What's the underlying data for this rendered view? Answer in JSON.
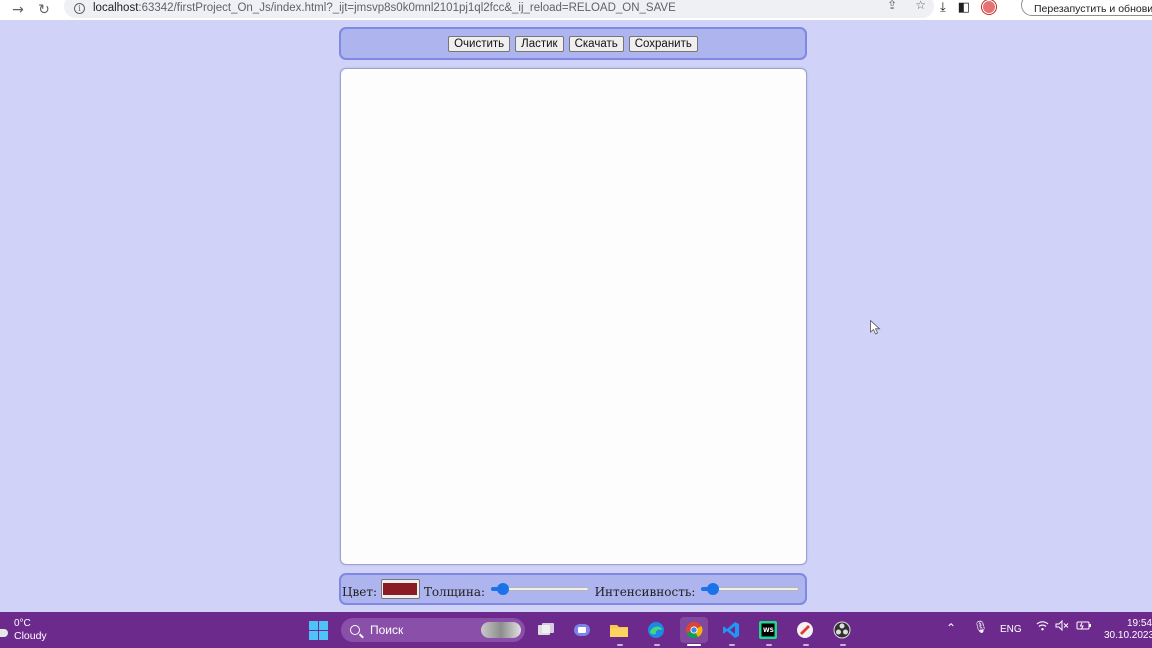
{
  "browser": {
    "url_host": "localhost",
    "url_rest": ":63342/firstProject_On_Js/index.html?_ijt=jmsvp8s0k0mnl2101pj1ql2fcc&_ij_reload=RELOAD_ON_SAVE",
    "restart_label": "Перезапустить и обновить",
    "icons": [
      "back-arrow-icon",
      "reload-icon",
      "info-icon",
      "share-icon",
      "star-icon",
      "download-icon",
      "sidepanel-icon",
      "profile-avatar"
    ]
  },
  "toolbar": {
    "clear": "Очистить",
    "eraser": "Ластик",
    "download": "Скачать",
    "save": "Сохранить"
  },
  "controls": {
    "color_label": "Цвет:",
    "color_value": "#8b1a24",
    "thickness_label": "Толщина:",
    "thickness_value": 0.12,
    "intensity_label": "Интенсивность:",
    "intensity_value": 0.12,
    "accent_color": "#1a73e8"
  },
  "taskbar": {
    "weather_temp": "0°C",
    "weather_desc": "Cloudy",
    "search_placeholder": "Поиск",
    "language": "ENG",
    "time": "19:54",
    "date": "30.10.2023"
  }
}
